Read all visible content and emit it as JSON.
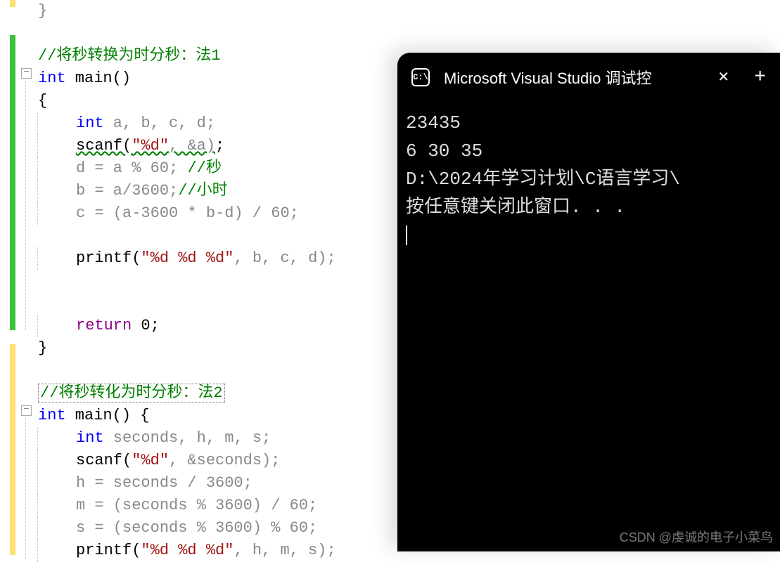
{
  "editor": {
    "comment1": "//将秒转换为时分秒：法1",
    "fn1_sig_int": "int",
    "fn1_sig_main": " main",
    "fn1_open": "{",
    "fn1_decl_int": "int",
    "fn1_decl_vars": " a, b, c, d;",
    "fn1_scanf": "scanf",
    "fn1_scanf_args_open": "(",
    "fn1_scanf_fmt": "\"%d\"",
    "fn1_scanf_args": ", &a)",
    "fn1_scanf_semi": ";",
    "fn1_line_d": "d = a % 60; ",
    "fn1_comment_sec": "//秒",
    "fn1_line_b": "b = a/3600;",
    "fn1_comment_hr": "//小时",
    "fn1_line_c": "c = (a-3600 * b-d) / 60;",
    "fn1_printf": "printf",
    "fn1_printf_fmt": "\"%d %d %d\"",
    "fn1_printf_args": ", b, c, d);",
    "fn1_return": "return",
    "fn1_return_val": " 0;",
    "fn1_close": "}",
    "comment2": "//将秒转化为时分秒：法2",
    "fn2_sig_int": "int",
    "fn2_sig_main": " main",
    "fn2_sig_brace": "() {",
    "fn2_decl_int": "int",
    "fn2_decl_vars": " seconds, h, m, s;",
    "fn2_scanf": "scanf",
    "fn2_scanf_fmt": "\"%d\"",
    "fn2_scanf_args": ", &seconds);",
    "fn2_line_h": "h = seconds / 3600;",
    "fn2_line_m": "m = (seconds % 3600) / 60;",
    "fn2_line_s": "s = (seconds % 3600) % 60;",
    "fn2_printf": "printf",
    "fn2_printf_fmt": "\"%d %d %d\"",
    "fn2_printf_args": ", h, m, s);"
  },
  "terminal": {
    "title": "Microsoft Visual Studio 调试控",
    "line1": "23435",
    "line2": "6 30 35",
    "line3": "D:\\2024年学习计划\\C语言学习\\",
    "line4": "按任意键关闭此窗口. . ."
  },
  "watermark": "CSDN @虔诚的电子小菜鸟"
}
